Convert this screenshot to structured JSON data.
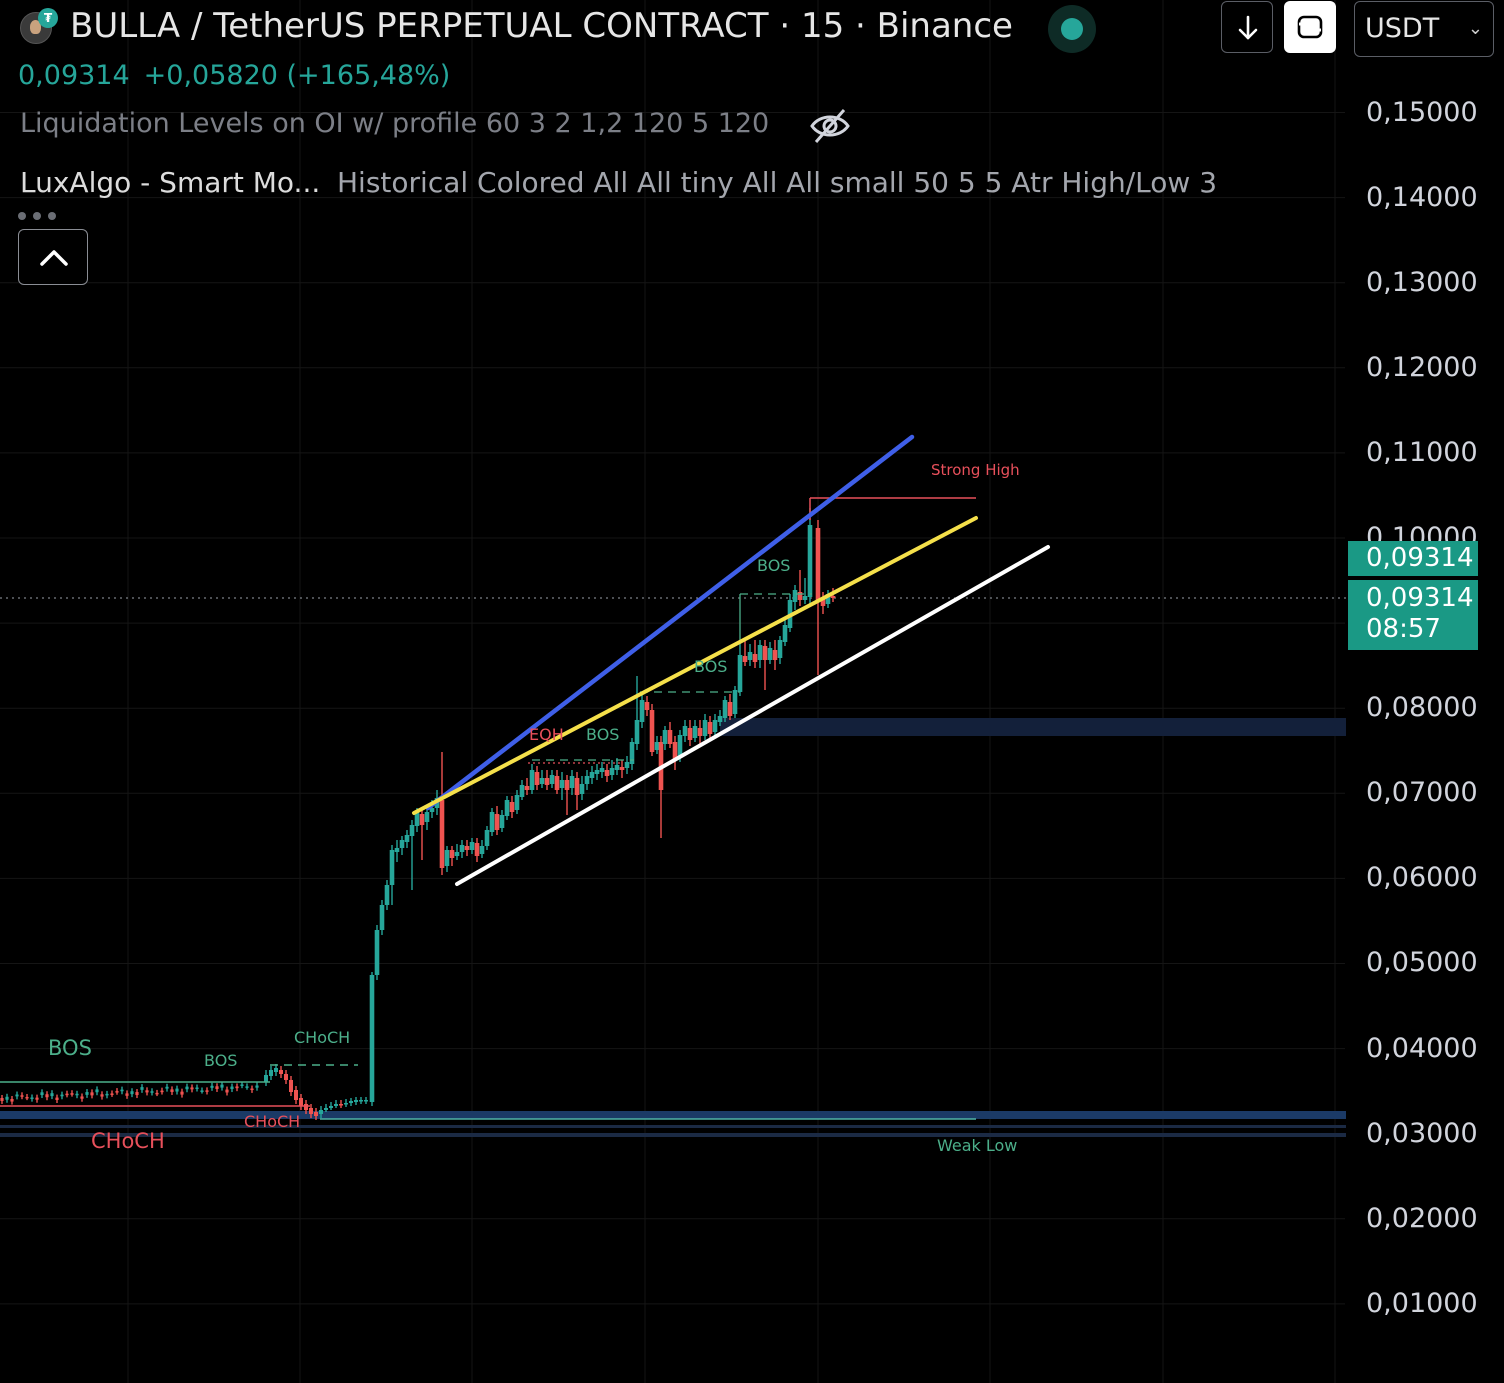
{
  "header": {
    "title": "BULLA / TetherUS PERPETUAL CONTRACT · 15 · Binance",
    "last_price": "0,09314",
    "change": "+0,05820 (+165,48%)",
    "indicator_1": "Liquidation Levels on OI w/ profile 60 3 2 1,2 120 5 120",
    "indicator_2_name": "LuxAlgo - Smart Mo...",
    "indicator_2_params": "Historical Colored All All tiny All All small 50 5 5 Atr High/Low 3"
  },
  "toolbar": {
    "currency": "USDT"
  },
  "price_axis": {
    "labels": [
      "0,15000",
      "0,14000",
      "0,13000",
      "0,12000",
      "0,11000",
      "0,10000",
      "0,08000",
      "0,07000",
      "0,06000",
      "0,05000",
      "0,04000",
      "0,03000",
      "0,02000",
      "0,01000"
    ],
    "last_price_tag": "0,09314",
    "countdown_price": "0,09314",
    "countdown_time": "08:57"
  },
  "chart_labels": {
    "strong_high": "Strong High",
    "weak_low": "Weak Low",
    "bos": "BOS",
    "choch": "CHoCH",
    "eqh": "EQH"
  },
  "colors": {
    "up": "#26a69a",
    "down": "#ef5350",
    "blue_line": "#3f5fe8",
    "yellow_line": "#f5e04a",
    "white_line": "#ffffff"
  }
}
